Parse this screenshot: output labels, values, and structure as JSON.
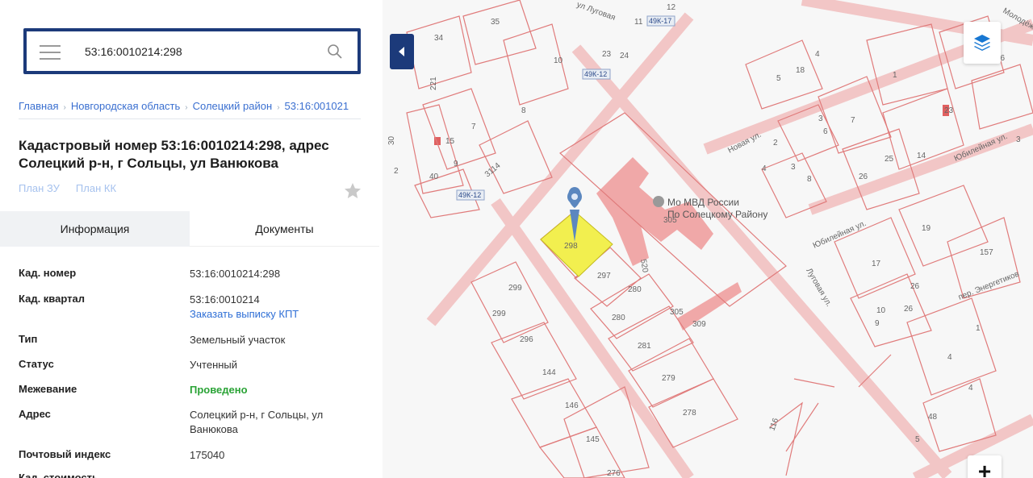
{
  "search": {
    "value": "53:16:0010214:298"
  },
  "breadcrumb": [
    "Главная",
    "Новгородская область",
    "Солецкий район",
    "53:16:001021"
  ],
  "title": "Кадастровый номер 53:16:0010214:298, адрес Солецкий р-н, г Сольцы, ул Ванюкова",
  "plan_links": [
    "План ЗУ",
    "План КК"
  ],
  "tabs": {
    "info": "Информация",
    "docs": "Документы"
  },
  "info": {
    "cad_number": {
      "label": "Кад. номер",
      "value": "53:16:0010214:298"
    },
    "cad_quarter": {
      "label": "Кад. квартал",
      "value": "53:16:0010214",
      "link": "Заказать выписку КПТ"
    },
    "type": {
      "label": "Тип",
      "value": "Земельный участок"
    },
    "status": {
      "label": "Статус",
      "value": "Учтенный"
    },
    "survey": {
      "label": "Межевание",
      "value": "Проведено"
    },
    "address": {
      "label": "Адрес",
      "value": "Солецкий р-н, г Сольцы, ул Ванюкова"
    },
    "postcode": {
      "label": "Почтовый индекс",
      "value": "175040"
    },
    "cost": {
      "label": "Кад. стоимость"
    }
  },
  "map": {
    "roads": [
      "49К-17",
      "49К-12",
      "49К-12"
    ],
    "streets": [
      "ул Луговая",
      "Новая ул.",
      "Юбилейная ул.",
      "Юбилейная ул.",
      "Луговая ул.",
      "пер. Энергетиков",
      "Молодёжная"
    ],
    "poi": [
      "Мо МВД России",
      "По Солецкому Району"
    ],
    "parcels": [
      "34",
      "35",
      "10",
      "23",
      "24",
      "221",
      "8",
      "7",
      "9",
      "15",
      "3114",
      "40",
      "30",
      "2",
      "299",
      "299",
      "296",
      "144",
      "146",
      "145",
      "276",
      "297",
      "280",
      "280",
      "281",
      "279",
      "278",
      "305",
      "305",
      "309",
      "520",
      "298",
      "116",
      "11",
      "12",
      "5",
      "18",
      "4",
      "1",
      "36",
      "2",
      "3",
      "23",
      "6",
      "7",
      "3",
      "25",
      "14",
      "4",
      "8",
      "26",
      "19",
      "17",
      "157",
      "26",
      "10",
      "9",
      "26",
      "4",
      "1",
      "48",
      "4",
      "5",
      "3"
    ],
    "plus_label": "+"
  },
  "colors": {
    "brand": "#1c3a7a",
    "parcel_line": "#e07b7b",
    "building": "#f0a8a8",
    "selected": "#f2ef4f",
    "marker": "#5b87bf"
  }
}
